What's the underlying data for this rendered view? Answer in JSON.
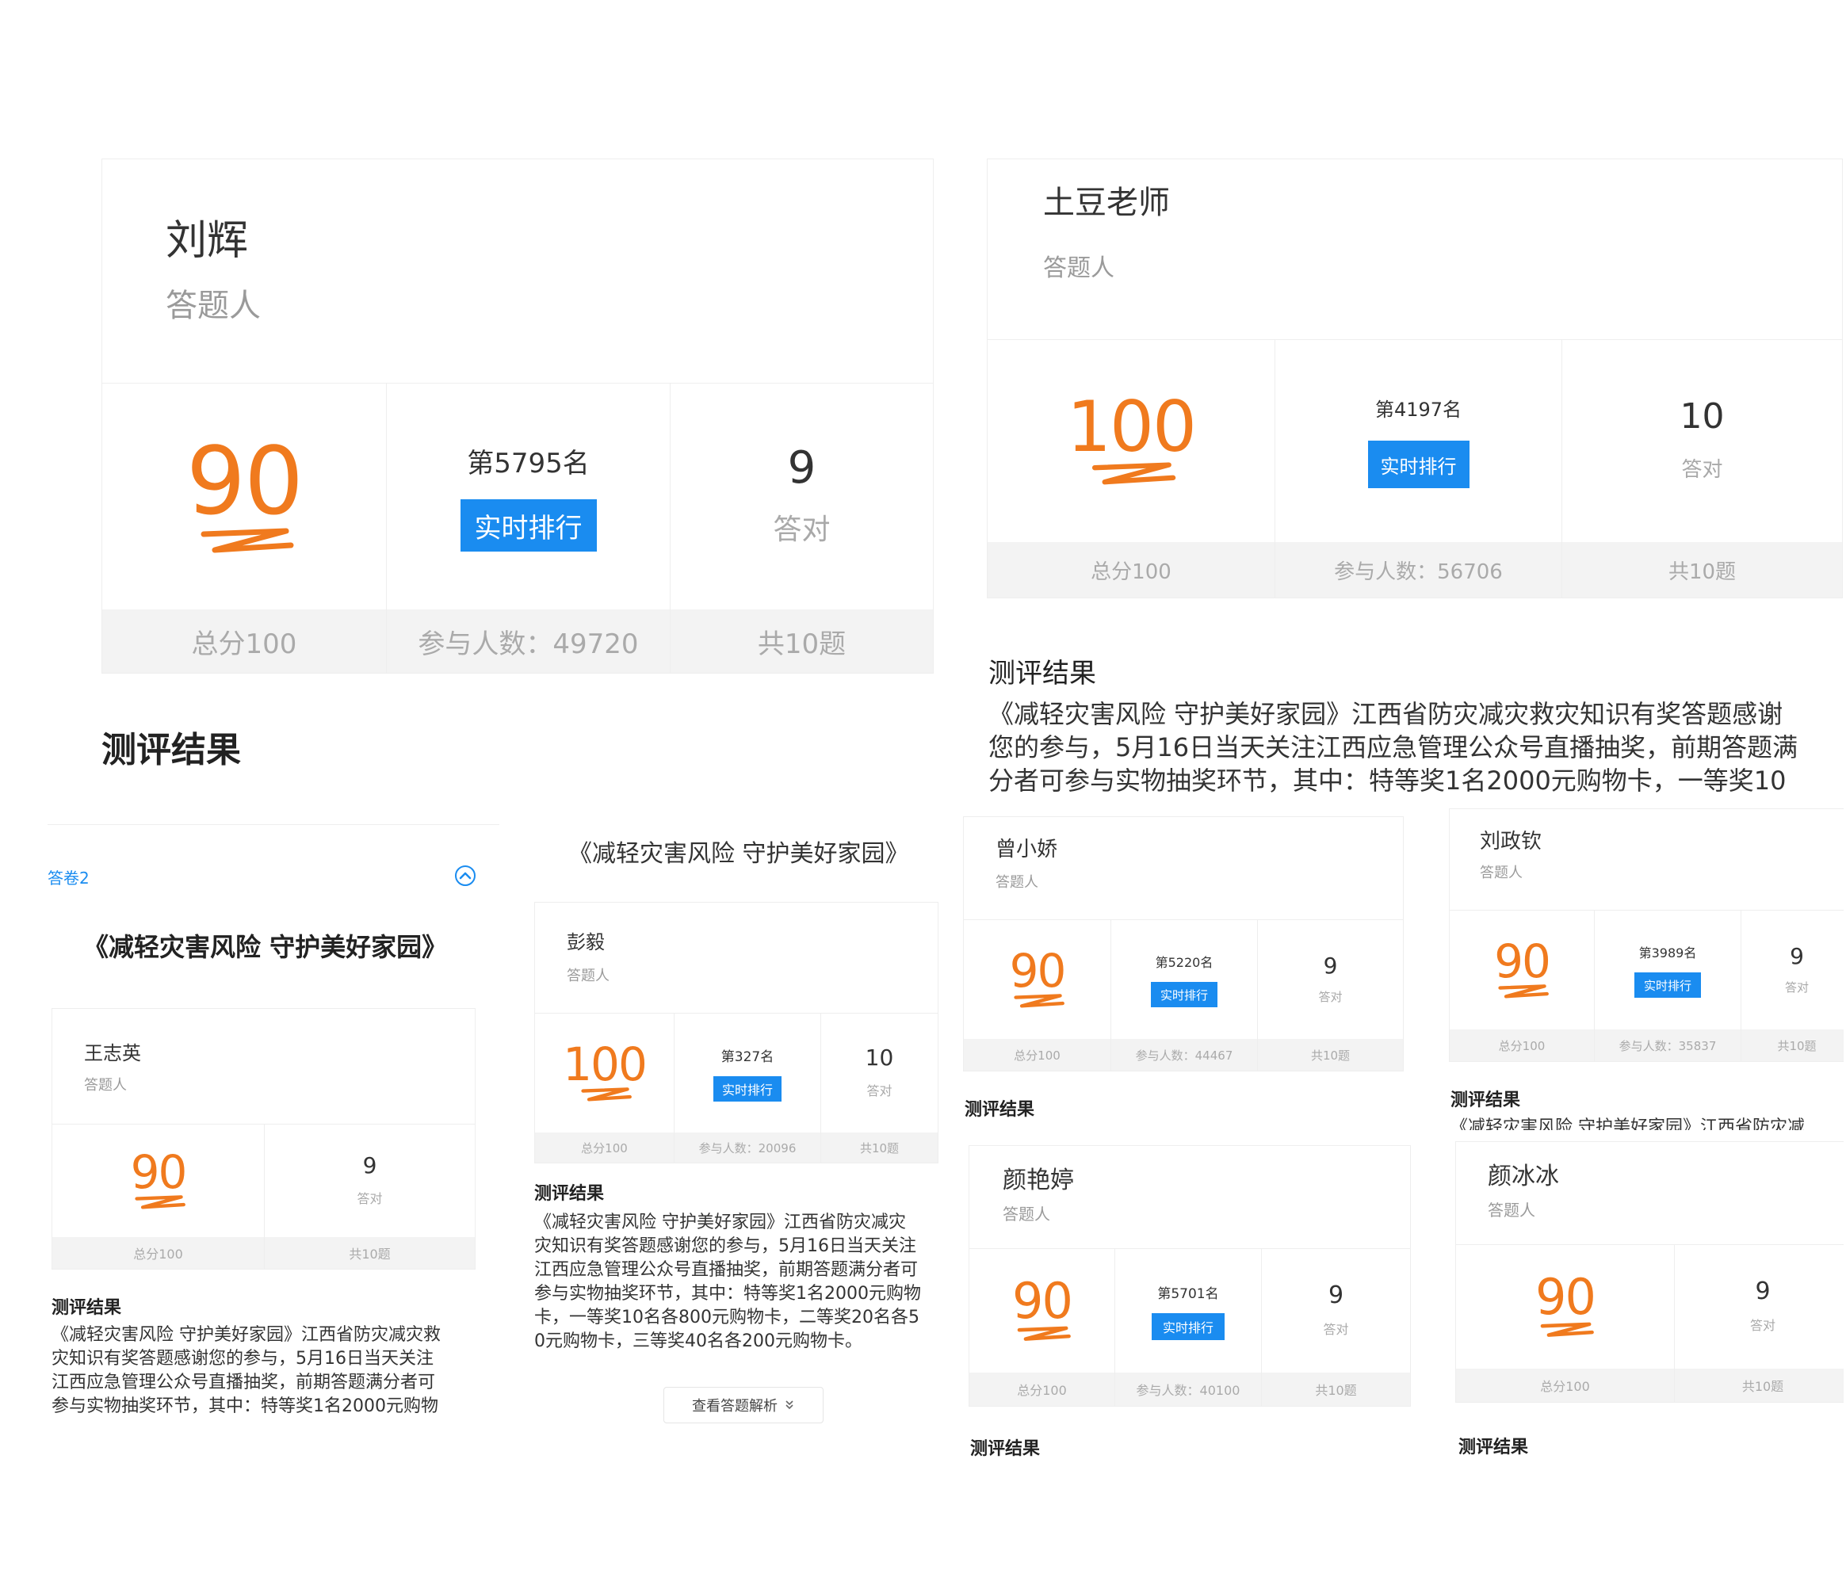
{
  "panels": {
    "p1": {
      "name": "刘辉",
      "role": "答题人",
      "score": "90",
      "score_total": "总分100",
      "rank": "第5795名",
      "rank_button": "实时排行",
      "participants": "参与人数：49720",
      "correct": "9",
      "correct_label": "答对",
      "total_q": "共10题",
      "section": "测评结果"
    },
    "p2": {
      "name": "土豆老师",
      "role": "答题人",
      "score": "100",
      "score_total": "总分100",
      "rank": "第4197名",
      "rank_button": "实时排行",
      "participants": "参与人数：56706",
      "correct": "10",
      "correct_label": "答对",
      "total_q": "共10题",
      "section": "测评结果",
      "body": [
        "《减轻灾害风险 守护美好家园》江西省防灾减灾救灾知识有奖答题感谢",
        "您的参与，5月16日当天关注江西应急管理公众号直播抽奖，前期答题满",
        "分者可参与实物抽奖环节，其中：特等奖1名2000元购物卡，一等奖10"
      ]
    },
    "p3": {
      "tab_label": "答卷2",
      "quiz_title": "《减轻灾害风险 守护美好家园》",
      "name": "王志英",
      "role": "答题人",
      "score": "90",
      "score_total": "总分100",
      "correct": "9",
      "correct_label": "答对",
      "total_q": "共10题",
      "section": "测评结果",
      "body": [
        "《减轻灾害风险 守护美好家园》江西省防灾减灾救",
        "灾知识有奖答题感谢您的参与，5月16日当天关注",
        "江西应急管理公众号直播抽奖，前期答题满分者可",
        "参与实物抽奖环节，其中：特等奖1名2000元购物"
      ]
    },
    "p4": {
      "quiz_title": "《减轻灾害风险 守护美好家园》",
      "name": "彭毅",
      "role": "答题人",
      "score": "100",
      "score_total": "总分100",
      "rank": "第327名",
      "rank_button": "实时排行",
      "participants": "参与人数：20096",
      "correct": "10",
      "correct_label": "答对",
      "total_q": "共10题",
      "section": "测评结果",
      "body": [
        "《减轻灾害风险 守护美好家园》江西省防灾减灾",
        "灾知识有奖答题感谢您的参与，5月16日当天关注",
        "江西应急管理公众号直播抽奖，前期答题满分者可",
        "参与实物抽奖环节，其中：特等奖1名2000元购物",
        "卡，一等奖10名各800元购物卡，二等奖20名各5",
        "0元购物卡，三等奖40名各200元购物卡。"
      ],
      "analysis_link": "查看答题解析"
    },
    "p5": {
      "name": "曾小娇",
      "role": "答题人",
      "score": "90",
      "score_total": "总分100",
      "rank": "第5220名",
      "rank_button": "实时排行",
      "participants": "参与人数：44467",
      "correct": "9",
      "correct_label": "答对",
      "total_q": "共10题",
      "section": "测评结果"
    },
    "p6": {
      "name": "刘政钦",
      "role": "答题人",
      "score": "90",
      "score_total": "总分100",
      "rank": "第3989名",
      "rank_button": "实时排行",
      "participants": "参与人数：35837",
      "correct": "9",
      "correct_label": "答对",
      "total_q": "共10题",
      "section": "测评结果",
      "body": [
        "《减轻灾害风险 守护美好家园》江西省防灾减"
      ]
    },
    "p7": {
      "name": "颜艳婷",
      "role": "答题人",
      "score": "90",
      "score_total": "总分100",
      "rank": "第5701名",
      "rank_button": "实时排行",
      "participants": "参与人数：40100",
      "correct": "9",
      "correct_label": "答对",
      "total_q": "共10题",
      "section": "测评结果"
    },
    "p8": {
      "name": "颜冰冰",
      "role": "答题人",
      "score": "90",
      "score_total": "总分100",
      "correct": "9",
      "correct_label": "答对",
      "total_q": "共10题",
      "section": "测评结果"
    }
  },
  "colors": {
    "score": "#f07a1e",
    "button": "#1a8cf0",
    "link": "#1a8cf0"
  },
  "icons": {
    "score_mark": "orange-swoosh-icon",
    "collapse": "chevron-up-circle-icon",
    "expand": "double-chevron-down-icon"
  }
}
